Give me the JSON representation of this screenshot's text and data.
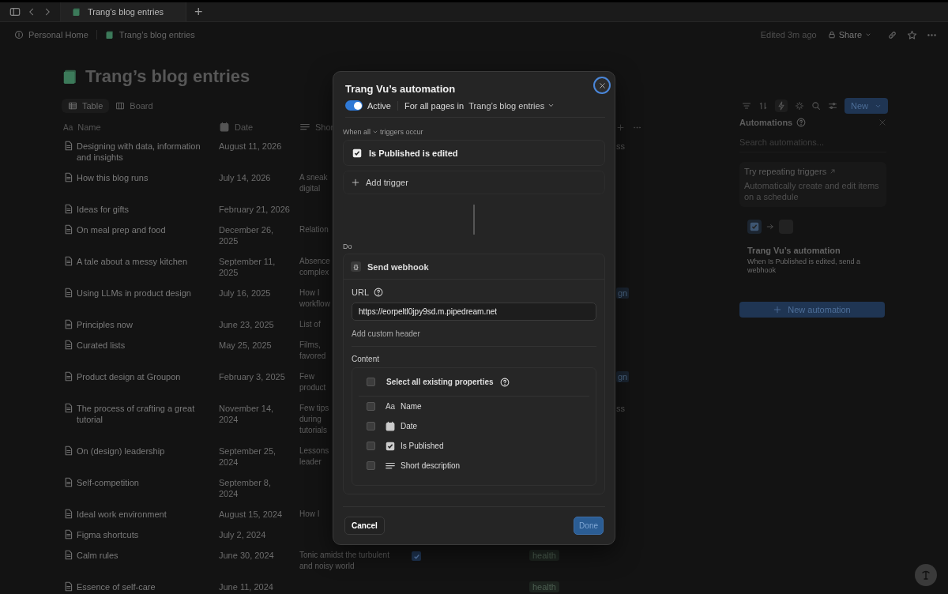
{
  "tab_bar": {
    "tabs": [
      {
        "label": "Trang’s blog entries",
        "selected": true
      }
    ],
    "new_tab": "+"
  },
  "breadcrumb": [
    {
      "label": "Personal Home",
      "kind": "home"
    },
    {
      "label": "Trang’s blog entries",
      "kind": "db"
    }
  ],
  "topbar": {
    "edited": "Edited 3m ago",
    "share": "Share"
  },
  "page": {
    "title": "Trang’s blog entries"
  },
  "views": [
    {
      "label": "Table",
      "kind": "table",
      "selected": true
    },
    {
      "label": "Board",
      "kind": "board",
      "selected": false
    }
  ],
  "toolbar": {
    "new_button": "New",
    "automations_active": true
  },
  "table": {
    "columns": [
      {
        "label": "Name",
        "kind": "text",
        "icon_text": "Aa"
      },
      {
        "label": "Date",
        "kind": "date"
      },
      {
        "label": "Shor",
        "kind": "lines"
      }
    ],
    "rows": [
      {
        "name": "Designing with data, information and insights",
        "date": "August 11, 2026",
        "right_tag": {
          "text": "ss",
          "kind": "plain"
        }
      },
      {
        "name": "How this blog runs",
        "date": "July 14, 2026",
        "description": [
          "A sneak",
          "digital"
        ]
      },
      {
        "name": "Ideas for gifts",
        "date": "February 21, 2026"
      },
      {
        "name": "On meal prep and food",
        "date": "December 26, 2025",
        "description": [
          "Relation"
        ]
      },
      {
        "name": "A tale about a messy kitchen",
        "date": "September 11, 2025",
        "description": [
          "Absence",
          "complex"
        ]
      },
      {
        "name": "Using LLMs in product design",
        "date": "July 16, 2025",
        "description": [
          "How I",
          "workflow"
        ],
        "right_tag": {
          "text": "gn",
          "kind": "badge"
        }
      },
      {
        "name": "Principles now",
        "date": "June 23, 2025",
        "description": [
          "List of"
        ]
      },
      {
        "name": "Curated lists",
        "date": "May 25, 2025",
        "description": [
          "Films,",
          "favored"
        ]
      },
      {
        "name": "Product design at Groupon",
        "date": "February 3, 2025",
        "description": [
          "Few",
          "product"
        ],
        "right_tag": {
          "text": "gn",
          "kind": "badge"
        }
      },
      {
        "name": "The process of crafting a great tutorial",
        "date": "November 14, 2024",
        "description": [
          "Few tips",
          "during",
          "tutorials"
        ],
        "right_tag": {
          "text": "ss",
          "kind": "plain"
        }
      },
      {
        "name": "On (design) leadership",
        "date": "September 25, 2024",
        "description": [
          "Lessons",
          "leader"
        ]
      },
      {
        "name": "Self-competition",
        "date": "September 8, 2024"
      },
      {
        "name": "Ideal work environment",
        "date": "August 15, 2024",
        "description": [
          "How I"
        ]
      },
      {
        "name": "Figma shortcuts",
        "date": "July 2, 2024"
      },
      {
        "name": "Calm rules",
        "date": "June 30, 2024",
        "description": [
          "Tonic amidst the turbulent",
          "and noisy world"
        ],
        "published": true,
        "tag": "health"
      },
      {
        "name": "Essence of self-care",
        "date": "June 11, 2024",
        "tag": "health"
      }
    ]
  },
  "automations_panel": {
    "title": "Automations",
    "search": {
      "placeholder": "Search automations..."
    },
    "promo": {
      "title": "Try repeating triggers",
      "text": "Automatically create and edit items on a schedule"
    },
    "items": [
      {
        "name": "Trang Vu’s automation",
        "summary": "When Is Published is edited, send a webhook"
      }
    ],
    "new_button": "New automation"
  },
  "modal": {
    "title": "Trang Vu’s automation",
    "active": true,
    "active_label": "Active",
    "scope_prefix": "For all pages in",
    "scope_db": "Trang’s blog entries",
    "when_all": "When all",
    "when_suffix": "triggers occur",
    "triggers": [
      {
        "label": "Is Published is edited"
      }
    ],
    "add_trigger": "Add trigger",
    "do_label": "Do",
    "action": {
      "icon_text": "{}",
      "title": "Send webhook",
      "url_label": "URL",
      "url": "https://eorpeltl0jpy9sd.m.pipedream.net",
      "add_header": "Add custom header",
      "content_label": "Content",
      "select_all": {
        "label": "Select all existing properties",
        "checked": false
      },
      "properties": [
        {
          "label": "Name",
          "kind": "text",
          "icon_text": "Aa",
          "checked": false
        },
        {
          "label": "Date",
          "kind": "date",
          "checked": false
        },
        {
          "label": "Is Published",
          "kind": "checkbox",
          "checked": false
        },
        {
          "label": "Short description",
          "kind": "lines",
          "checked": false
        }
      ]
    },
    "cancel": "Cancel",
    "done": "Done"
  }
}
